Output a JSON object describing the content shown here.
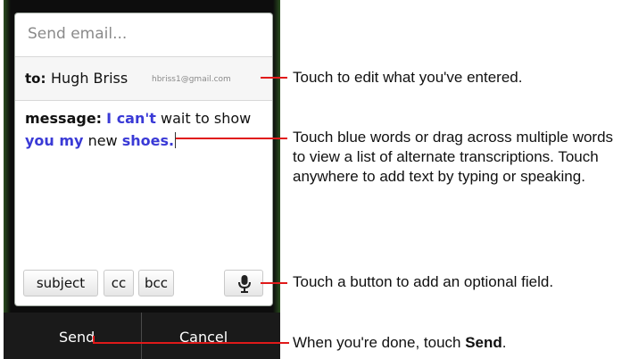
{
  "compose": {
    "title_placeholder": "Send email...",
    "to_label": "to:",
    "to_name": "Hugh Briss",
    "to_address": "hbriss1@gmail.com",
    "message_label": "message:",
    "message_words": [
      {
        "text": "I can't",
        "blue": true
      },
      {
        "text": " wait to show ",
        "blue": false
      },
      {
        "text": "you my",
        "blue": true
      },
      {
        "text": " new ",
        "blue": false
      },
      {
        "text": "shoes.",
        "blue": true
      }
    ]
  },
  "fields": {
    "subject": "subject",
    "cc": "cc",
    "bcc": "bcc",
    "mic_icon": "microphone-icon"
  },
  "actions": {
    "send": "Send",
    "cancel": "Cancel"
  },
  "callouts": {
    "edit": "Touch to edit what you've entered.",
    "blue_words": "Touch blue words or drag across multiple words to view a list of alternate transcriptions. Touch anywhere to add text by typing or speaking.",
    "add_field": "Touch a button to add an optional field.",
    "done_prefix": "When you're done, touch ",
    "done_bold": "Send",
    "done_suffix": "."
  },
  "colors": {
    "callout_line": "#e01a1a",
    "blue_word": "#3a3ad6"
  }
}
